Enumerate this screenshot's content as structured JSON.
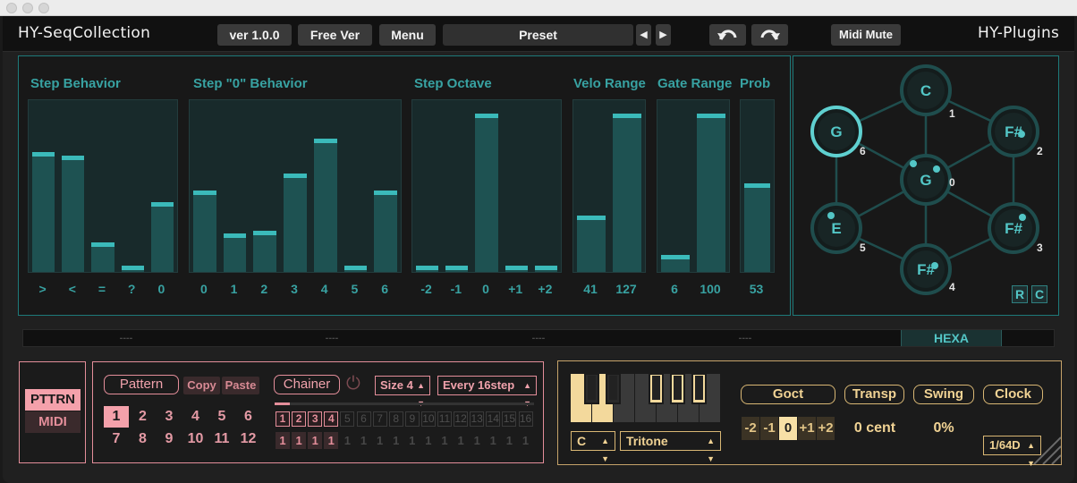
{
  "header": {
    "app_name": "HY-SeqCollection",
    "version_label": "ver 1.0.0",
    "edition_label": "Free Ver",
    "menu_label": "Menu",
    "preset_label": "Preset",
    "prev_arrow": "◀",
    "next_arrow": "▶",
    "midi_mute_label": "Midi Mute",
    "vendor_name": "HY-Plugins"
  },
  "steps": {
    "step_behavior": {
      "title": "Step Behavior",
      "labels": [
        ">",
        "<",
        "=",
        "?",
        "0"
      ],
      "values": [
        0.72,
        0.7,
        0.18,
        0.04,
        0.42
      ]
    },
    "step_zero_behavior": {
      "title": "Step \"0\" Behavior",
      "labels": [
        "0",
        "1",
        "2",
        "3",
        "4",
        "5",
        "6"
      ],
      "values": [
        0.49,
        0.23,
        0.25,
        0.59,
        0.8,
        0.04,
        0.49
      ]
    },
    "step_octave": {
      "title": "Step Octave",
      "labels": [
        "-2",
        "-1",
        "0",
        "+1",
        "+2"
      ],
      "values": [
        0.04,
        0.04,
        0.95,
        0.04,
        0.04
      ]
    },
    "velo_range": {
      "title": "Velo Range",
      "labels": [
        "41",
        "127"
      ],
      "values": [
        0.34,
        0.95
      ]
    },
    "gate_range": {
      "title": "Gate Range",
      "labels": [
        "6",
        "100"
      ],
      "values": [
        0.1,
        0.95
      ]
    },
    "prob": {
      "title": "Prob",
      "labels": [
        "53"
      ],
      "values": [
        0.53
      ]
    }
  },
  "hexa": {
    "nodes": [
      {
        "note": "G",
        "index": "0"
      },
      {
        "note": "C",
        "index": "1"
      },
      {
        "note": "F#",
        "index": "2"
      },
      {
        "note": "F#",
        "index": "3"
      },
      {
        "note": "F#",
        "index": "4"
      },
      {
        "note": "E",
        "index": "5"
      },
      {
        "note": "G",
        "index": "6"
      }
    ],
    "r_label": "R",
    "c_label": "C"
  },
  "tabs": [
    "----",
    "----",
    "----",
    "----",
    "HEXA"
  ],
  "mode": {
    "pattern_label": "PTTRN",
    "midi_label": "MIDI"
  },
  "pattern": {
    "pattern_label": "Pattern",
    "copy_label": "Copy",
    "paste_label": "Paste",
    "numbers": [
      "1",
      "2",
      "3",
      "4",
      "5",
      "6",
      "7",
      "8",
      "9",
      "10",
      "11",
      "12"
    ],
    "selected": "1"
  },
  "chainer": {
    "label": "Chainer",
    "power_icon": "⏻",
    "size_label": "Size 4",
    "every_label": "Every 16step",
    "steps": [
      "1",
      "2",
      "3",
      "4",
      "5",
      "6",
      "7",
      "8",
      "9",
      "10",
      "11",
      "12",
      "13",
      "14",
      "15",
      "16"
    ],
    "values": [
      "1",
      "1",
      "1",
      "1",
      "1",
      "1",
      "1",
      "1",
      "1",
      "1",
      "1",
      "1",
      "1",
      "1",
      "1",
      "1"
    ],
    "active_count": 4,
    "progress": 0.06
  },
  "scale": {
    "root_label": "C",
    "scale_label": "Tritone",
    "highlight_keys": [
      "C",
      "D",
      "F#",
      "G#",
      "A#"
    ]
  },
  "goct": {
    "label": "Goct",
    "options": [
      "-2",
      "-1",
      "0",
      "+1",
      "+2"
    ],
    "selected": "0"
  },
  "transp": {
    "label": "Transp",
    "value": "0 cent"
  },
  "swing": {
    "label": "Swing",
    "value": "0%"
  },
  "clock": {
    "label": "Clock",
    "value": "1/64D"
  },
  "colors": {
    "teal": "#38a2a2",
    "pink": "#e48e9a",
    "gold": "#d9b774"
  }
}
